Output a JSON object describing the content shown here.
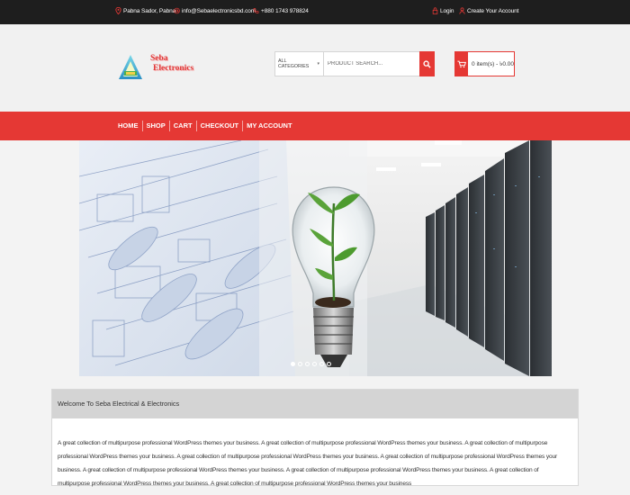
{
  "topbar": {
    "address": "Pabna Sador, Pabna",
    "email": "info@Sebaelectronicsbd.com",
    "phone": "+880 1743 978824",
    "login_label": "Login",
    "create_account_label": "Create Your Account"
  },
  "brand": {
    "name_line1": "Seba",
    "name_line2": "Electronics"
  },
  "search": {
    "category_label": "ALL CATEGORIES",
    "placeholder": "PRODUCT SEARCH..."
  },
  "cart": {
    "summary": "0 item(s) - ৳0.00"
  },
  "nav": {
    "items": [
      "HOME",
      "SHOP",
      "CART",
      "CHECKOUT",
      "MY ACCOUNT"
    ]
  },
  "slider": {
    "dot_count": 6,
    "active_index": 0
  },
  "welcome": {
    "title": "Welcome To Seba Electrical & Electronics",
    "body": "A great collection of multipurpose professional WordPress themes your business. A great collection of multipurpose professional WordPress themes your business. A great collection of multipurpose professional WordPress themes your business. A great collection of multipurpose professional WordPress themes your business. A great collection of multipurpose professional WordPress themes your business. A great collection of multipurpose professional WordPress themes your business. A great collection of multipurpose professional WordPress themes your business. A great collection of multipurpose professional WordPress themes your business. A great collection of multipurpose professional WordPress themes your business"
  },
  "colors": {
    "accent": "#e53834",
    "topbar_bg": "#1e1e1e",
    "header_bg": "#f1f1f1"
  }
}
